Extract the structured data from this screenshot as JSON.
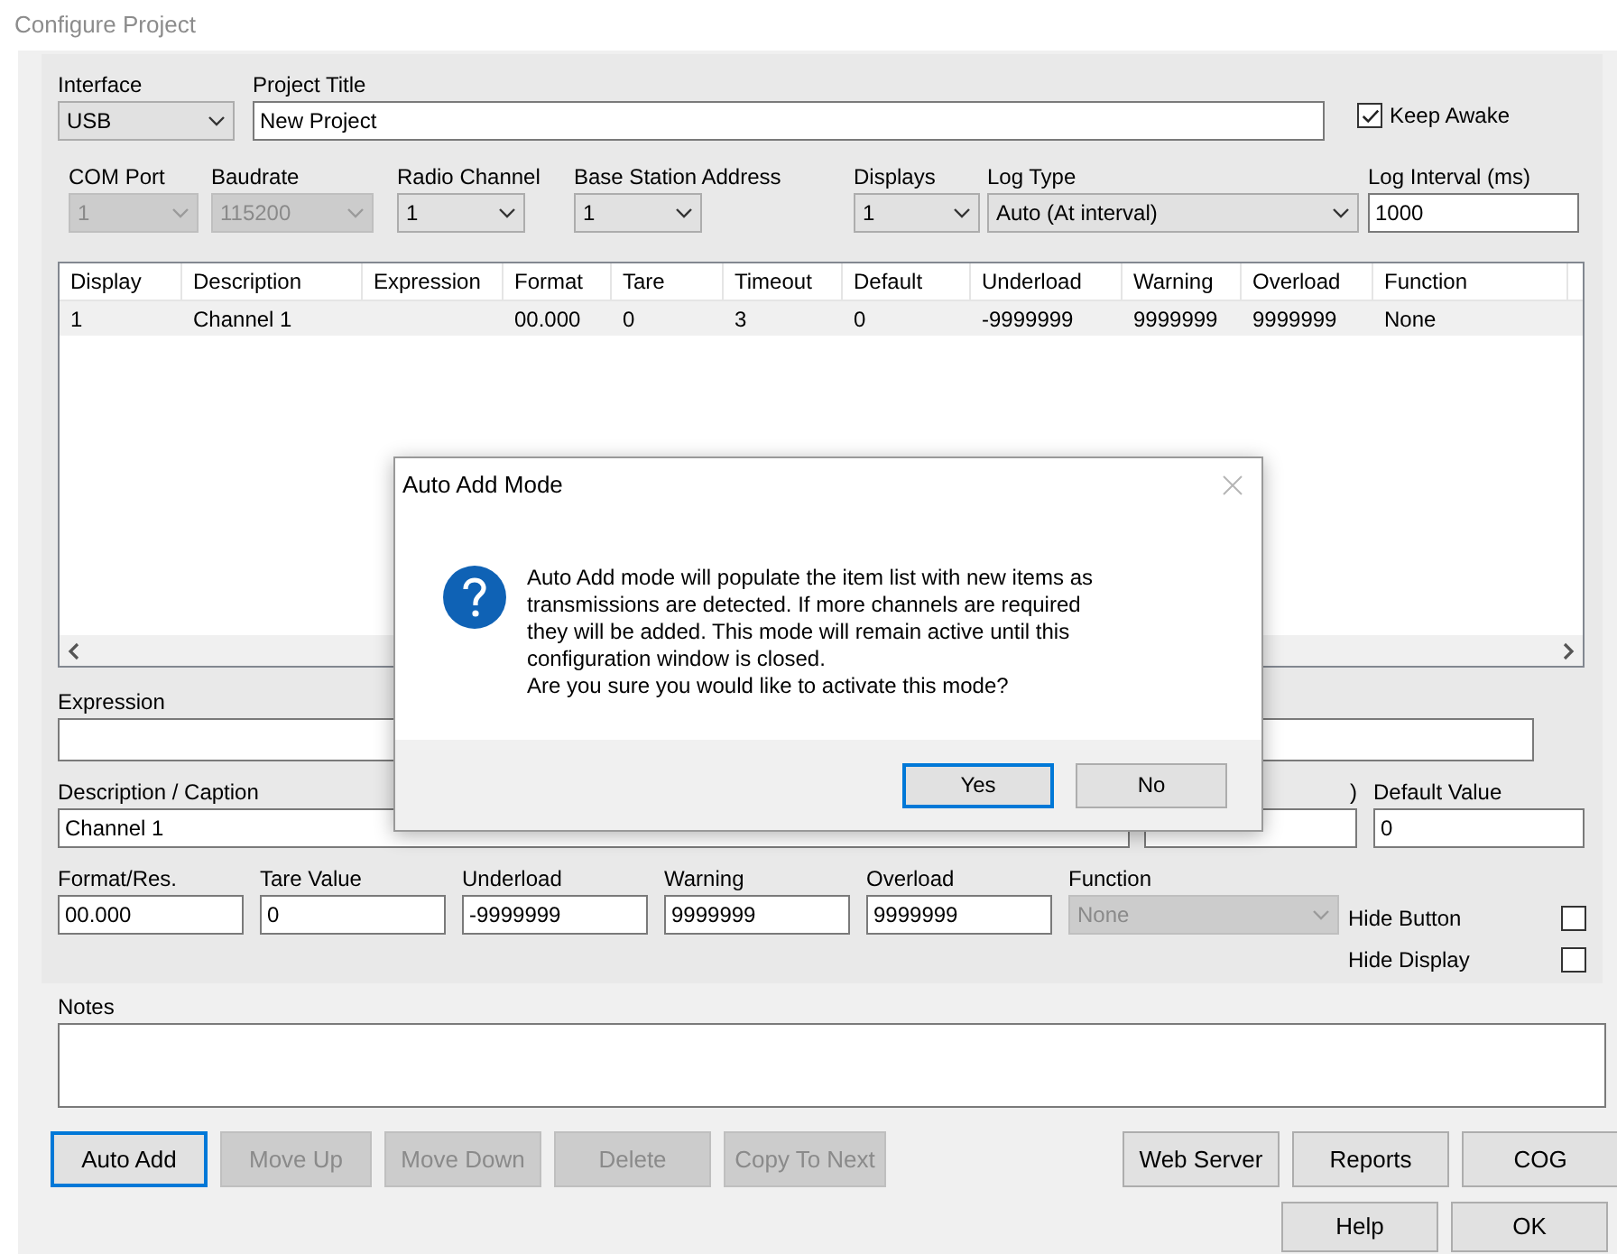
{
  "window": {
    "title": "Configure Project"
  },
  "interface": {
    "label": "Interface",
    "value": "USB"
  },
  "project_title": {
    "label": "Project Title",
    "value": "New Project"
  },
  "keep_awake": {
    "label": "Keep Awake",
    "checked": true
  },
  "connection": [
    {
      "label": "COM Port",
      "value": "1",
      "disabled": true
    },
    {
      "label": "Baudrate",
      "value": "115200",
      "disabled": true
    },
    {
      "label": "Radio Channel",
      "value": "1",
      "disabled": false
    },
    {
      "label": "Base Station Address",
      "value": "1",
      "disabled": false
    },
    {
      "label": "Displays",
      "value": "1",
      "disabled": false
    },
    {
      "label": "Log Type",
      "value": "Auto (At interval)",
      "disabled": false
    }
  ],
  "log_interval": {
    "label": "Log Interval (ms)",
    "value": "1000"
  },
  "table": {
    "columns": [
      "Display",
      "Description",
      "Expression",
      "Format",
      "Tare",
      "Timeout",
      "Default",
      "Underload",
      "Warning",
      "Overload",
      "Function"
    ],
    "rows": [
      {
        "selected": true,
        "cells": [
          "1",
          "Channel 1",
          "",
          "00.000",
          "0",
          "3",
          "0",
          "-9999999",
          "9999999",
          "9999999",
          "None"
        ]
      }
    ]
  },
  "expression": {
    "label": "Expression"
  },
  "description": {
    "label": "Description / Caption",
    "value": "Channel 1"
  },
  "timeout": {
    "label": ")"
  },
  "default_value": {
    "label": "Default Value",
    "value": "0"
  },
  "limits": [
    {
      "label": "Format/Res.",
      "value": "00.000"
    },
    {
      "label": "Tare Value",
      "value": "0"
    },
    {
      "label": "Underload",
      "value": "-9999999"
    },
    {
      "label": "Warning",
      "value": "9999999"
    },
    {
      "label": "Overload",
      "value": "9999999"
    }
  ],
  "function": {
    "label": "Function",
    "value": "None"
  },
  "hide_options": [
    {
      "label": "Hide Button",
      "checked": false
    },
    {
      "label": "Hide Display",
      "checked": false
    }
  ],
  "notes": {
    "label": "Notes"
  },
  "buttons": [
    {
      "label": "Auto Add",
      "disabled": false,
      "focused": true
    },
    {
      "label": "Move Up",
      "disabled": true,
      "focused": false
    },
    {
      "label": "Move Down",
      "disabled": true,
      "focused": false
    },
    {
      "label": "Delete",
      "disabled": true,
      "focused": false
    },
    {
      "label": "Copy To Next",
      "disabled": true,
      "focused": false
    }
  ],
  "right_buttons": [
    {
      "label": "Web Server"
    },
    {
      "label": "Reports"
    },
    {
      "label": "COG"
    }
  ],
  "bottom_buttons": [
    {
      "label": "Help"
    },
    {
      "label": "OK"
    }
  ],
  "dialog": {
    "title": "Auto Add Mode",
    "paragraphs": [
      "Auto Add mode will populate the item list with new items as transmissions are detected. If more channels are required they will be added. This mode will remain active until this configuration window is closed.",
      "Are you sure you would like to activate this mode?"
    ],
    "buttons": [
      {
        "label": "Yes",
        "focused": true
      },
      {
        "label": "No",
        "focused": false
      }
    ]
  }
}
